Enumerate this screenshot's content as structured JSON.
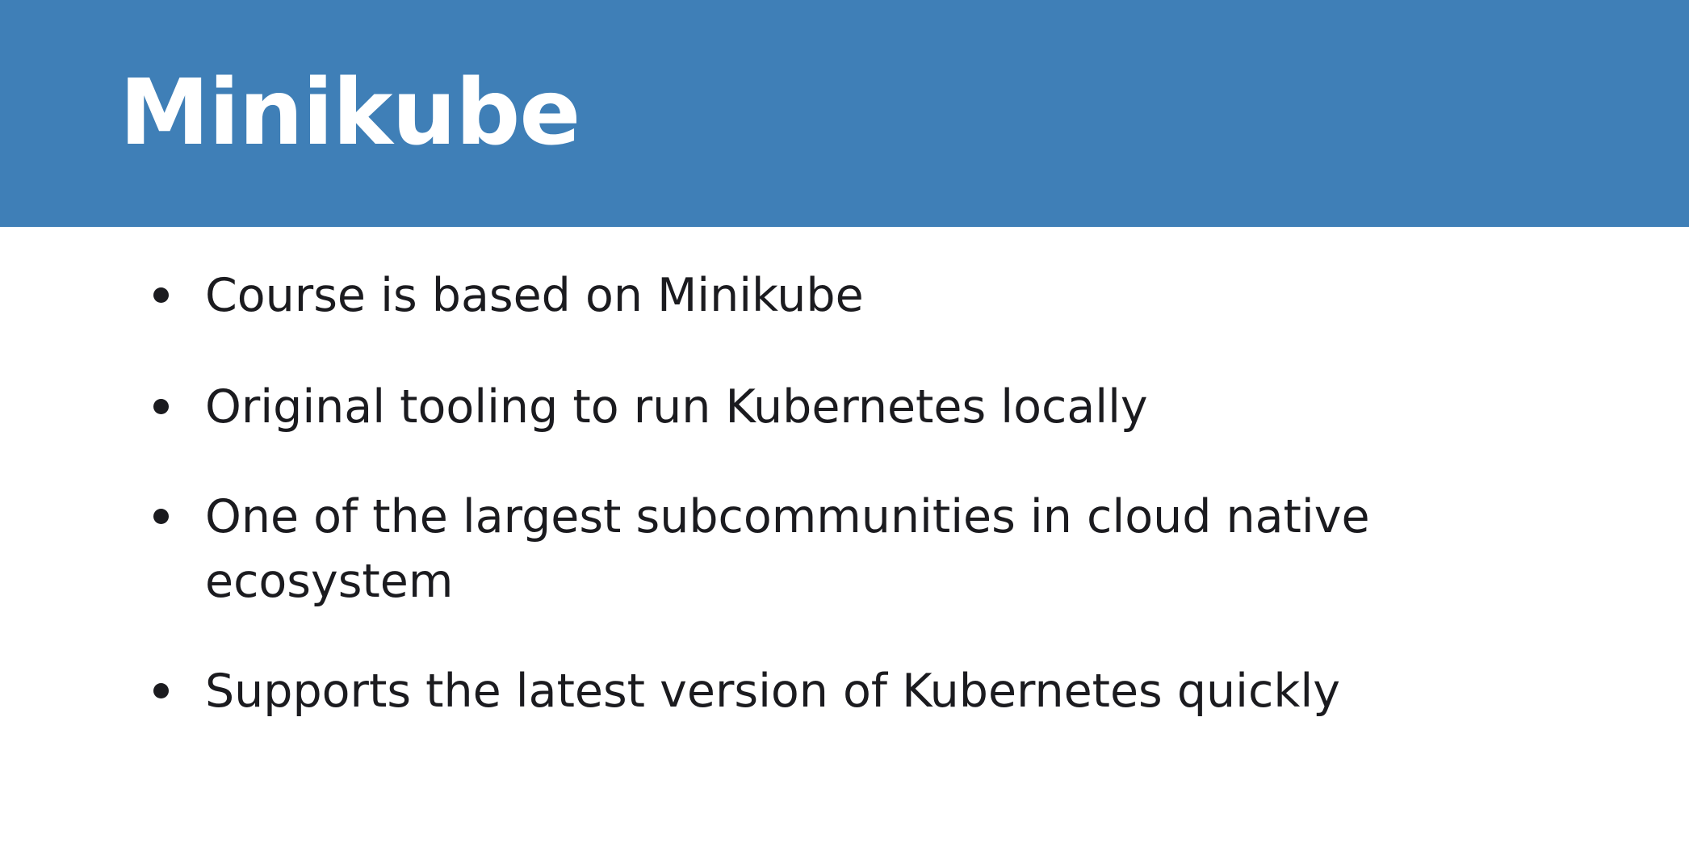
{
  "slide": {
    "title": "Minikube",
    "bullets": [
      "Course is based on Minikube",
      "Original tooling to run Kubernetes locally",
      "One of the largest subcommunities in cloud native ecosystem",
      "Supports the latest version of Kubernetes quickly"
    ]
  },
  "colors": {
    "title_bar": "#3f7fb7",
    "title_text": "#ffffff",
    "body_text": "#1b1b1f",
    "background": "#ffffff"
  }
}
